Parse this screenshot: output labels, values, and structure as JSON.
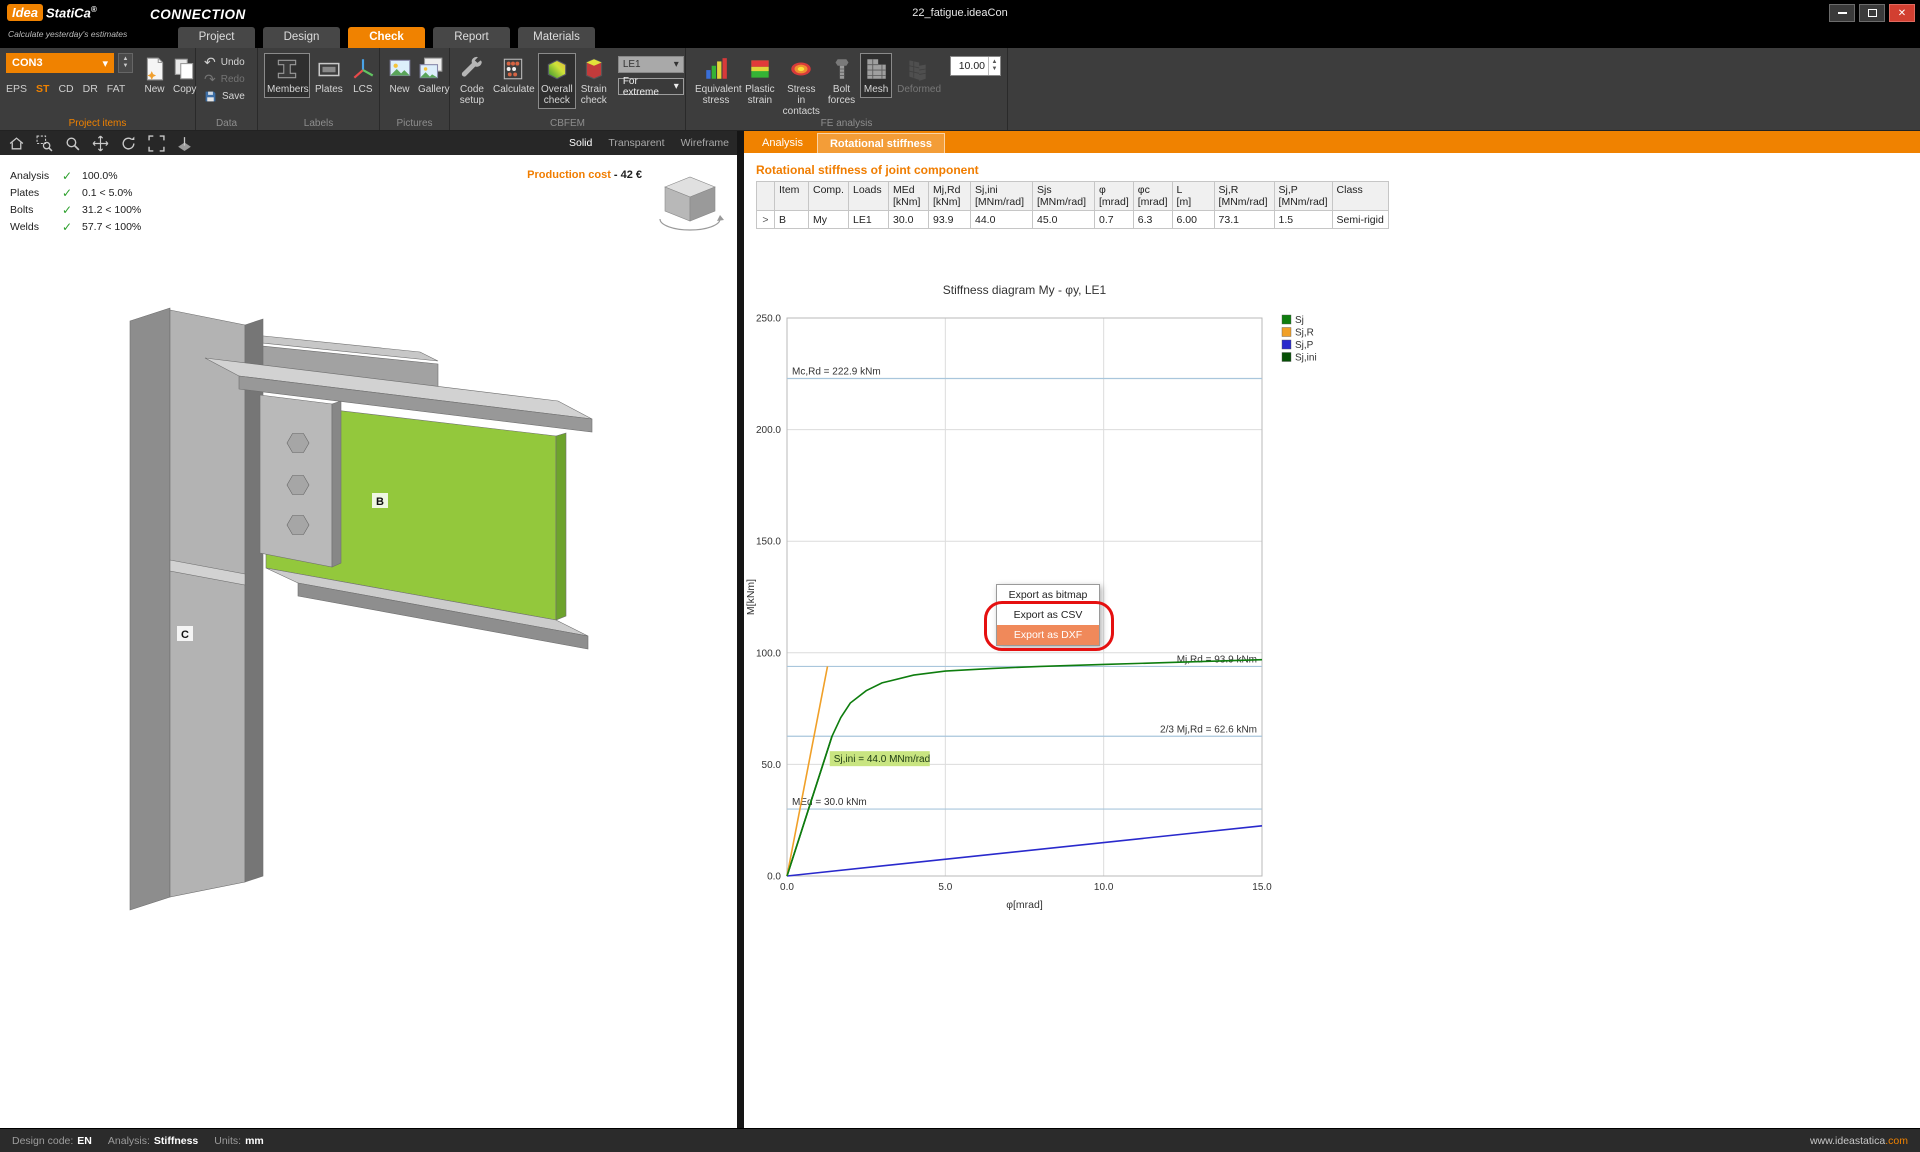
{
  "titlebar": {
    "logo_primary": "Idea",
    "logo_secondary": "StatiCa",
    "logo_reg": "®",
    "app_name": "CONNECTION",
    "tagline": "Calculate yesterday's estimates",
    "document_title": "22_fatigue.ideaCon",
    "window_controls": [
      "minimize",
      "maximize",
      "close"
    ]
  },
  "ribbon_tabs": {
    "items": [
      {
        "label": "Project",
        "active": false
      },
      {
        "label": "Design",
        "active": false
      },
      {
        "label": "Check",
        "active": true
      },
      {
        "label": "Report",
        "active": false
      },
      {
        "label": "Materials",
        "active": false
      }
    ]
  },
  "ribbon": {
    "project_items": {
      "group_label": "Project items",
      "selected_project": "CON3",
      "modes": [
        "EPS",
        "ST",
        "CD",
        "DR",
        "FAT"
      ],
      "active_mode": "ST",
      "new_label": "New",
      "copy_label": "Copy"
    },
    "data_group": {
      "group_label": "Data",
      "undo": "Undo",
      "redo": "Redo",
      "save": "Save"
    },
    "labels_group": {
      "group_label": "Labels",
      "members": "Members",
      "plates": "Plates",
      "lcs": "LCS"
    },
    "pictures_group": {
      "group_label": "Pictures",
      "new": "New",
      "gallery": "Gallery"
    },
    "cbfem_group": {
      "group_label": "CBFEM",
      "code_setup": "Code setup",
      "calculate": "Calculate",
      "overall_check": "Overall check",
      "strain_check": "Strain check",
      "load_effect": "LE1",
      "extreme": "For extreme"
    },
    "fe_group": {
      "group_label": "FE analysis",
      "equivalent_stress": "Equivalent stress",
      "plastic_strain": "Plastic strain",
      "stress_contacts": "Stress in contacts",
      "bolt_forces": "Bolt forces",
      "mesh": "Mesh",
      "deformed": "Deformed",
      "scale_value": "10.00"
    }
  },
  "viewer": {
    "display_modes": [
      "Solid",
      "Transparent",
      "Wireframe"
    ],
    "active_display_mode": "Solid",
    "checks": [
      {
        "name": "Analysis",
        "status": "✓",
        "value": "100.0%"
      },
      {
        "name": "Plates",
        "status": "✓",
        "value": "0.1 < 5.0%"
      },
      {
        "name": "Bolts",
        "status": "✓",
        "value": "31.2 < 100%"
      },
      {
        "name": "Welds",
        "status": "✓",
        "value": "57.7 < 100%"
      }
    ],
    "production_cost_label": "Production cost",
    "production_cost_sep": "-",
    "production_cost_value": "42 €",
    "member_b": "B",
    "member_c": "C"
  },
  "results": {
    "tab_analysis": "Analysis",
    "tab_stiffness": "Rotational stiffness",
    "active_tab": "Rotational stiffness",
    "heading": "Rotational stiffness of joint component",
    "table": {
      "columns": [
        {
          "label": "Item",
          "unit": ""
        },
        {
          "label": "Comp.",
          "unit": ""
        },
        {
          "label": "Loads",
          "unit": ""
        },
        {
          "label": "MEd",
          "unit": "[kNm]"
        },
        {
          "label": "Mj,Rd",
          "unit": "[kNm]"
        },
        {
          "label": "Sj,ini",
          "unit": "[MNm/rad]"
        },
        {
          "label": "Sjs",
          "unit": "[MNm/rad]"
        },
        {
          "label": "φ",
          "unit": "[mrad]"
        },
        {
          "label": "φc",
          "unit": "[mrad]"
        },
        {
          "label": "L",
          "unit": "[m]"
        },
        {
          "label": "Sj,R",
          "unit": "[MNm/rad]"
        },
        {
          "label": "Sj,P",
          "unit": "[MNm/rad]"
        },
        {
          "label": "Class",
          "unit": ""
        }
      ],
      "rows": [
        {
          "expander": ">",
          "cells": [
            "B",
            "My",
            "LE1",
            "30.0",
            "93.9",
            "44.0",
            "45.0",
            "0.7",
            "6.3",
            "6.00",
            "73.1",
            "1.5",
            "Semi-rigid"
          ]
        }
      ]
    }
  },
  "chart_data": {
    "type": "line",
    "title": "Stiffness diagram My - φy, LE1",
    "xlabel": "φ[mrad]",
    "ylabel": "M[kNm]",
    "xlim": [
      0,
      15
    ],
    "ylim": [
      0,
      250
    ],
    "xticks": [
      0,
      5,
      10,
      15
    ],
    "yticks": [
      0,
      50,
      100,
      150,
      200,
      250
    ],
    "grid": true,
    "legend_position": "top-right",
    "series": [
      {
        "name": "Sj",
        "color": "#0e7d0e",
        "points": [
          [
            0,
            0
          ],
          [
            0.4,
            17.6
          ],
          [
            0.8,
            35.2
          ],
          [
            1.1,
            48.4
          ],
          [
            1.42,
            62.6
          ],
          [
            1.7,
            71
          ],
          [
            2.0,
            77.5
          ],
          [
            2.5,
            83
          ],
          [
            3.0,
            86.5
          ],
          [
            4.0,
            90
          ],
          [
            5.0,
            91.8
          ],
          [
            6.5,
            93
          ],
          [
            8.0,
            93.9
          ],
          [
            10.0,
            94.8
          ],
          [
            12.0,
            95.6
          ],
          [
            15.0,
            96.9
          ]
        ]
      },
      {
        "name": "Sj,R",
        "color": "#f0a028",
        "points": [
          [
            0,
            0
          ],
          [
            1.28,
            93.9
          ]
        ]
      },
      {
        "name": "Sj,P",
        "color": "#2929cc",
        "points": [
          [
            0,
            0
          ],
          [
            15,
            22.5
          ]
        ]
      },
      {
        "name": "Sj,ini",
        "color": "#064f06",
        "points": [
          [
            0,
            0
          ],
          [
            1.42,
            62.6
          ]
        ]
      }
    ],
    "reference_lines": [
      {
        "label": "Mc,Rd = 222.9 kNm",
        "value": 222.9,
        "label_side": "left"
      },
      {
        "label": "Mj,Rd = 93.9 kNm",
        "value": 93.9,
        "label_side": "right"
      },
      {
        "label": "2/3 Mj,Rd = 62.6 kNm",
        "value": 62.6,
        "label_side": "right"
      },
      {
        "label": "MEd = 30.0 kNm",
        "value": 30.0,
        "label_side": "left"
      }
    ],
    "annotation": {
      "text": "Sj,ini = 44.0 MNm/rad",
      "x": 1.35,
      "y": 51,
      "bg": "#c9e581"
    }
  },
  "context_menu": {
    "items": [
      {
        "label": "Export as bitmap",
        "highlight": false
      },
      {
        "label": "Export as CSV",
        "highlight": false
      },
      {
        "label": "Export as DXF",
        "highlight": true
      }
    ]
  },
  "statusbar": {
    "design_code_label": "Design code:",
    "design_code": "EN",
    "analysis_label": "Analysis:",
    "analysis": "Stiffness",
    "units_label": "Units:",
    "units": "mm",
    "website_base": "www.ideastatica",
    "website_tld": ".com"
  }
}
